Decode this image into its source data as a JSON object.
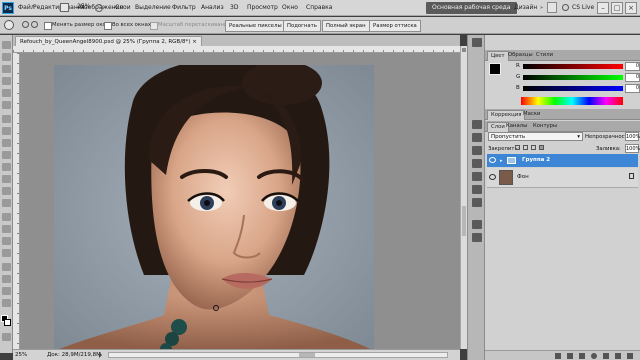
{
  "app": {
    "logo": "Ps"
  },
  "menu": {
    "items": [
      "Файл",
      "Редактирование",
      "Изображение",
      "Слои",
      "Выделение",
      "Фильтр",
      "Анализ",
      "3D",
      "Просмотр",
      "Окно",
      "Справка"
    ],
    "zoom": "25%",
    "workspace_active": "Основная рабочая среда",
    "workspace_other": "Дизайн",
    "cslive": "CS Live"
  },
  "options": {
    "resize_windows": "Менять размер окон",
    "all_windows": "Во всех окнах",
    "scrubby_zoom": "Масштаб перетаскиванием",
    "actual_pixels": "Реальные пикселы",
    "fit_screen": "Подогнать",
    "fill_screen": "Полный экран",
    "print_size": "Размер оттиска"
  },
  "document": {
    "tab_title": "Refouch_by_QueenAngel8900.psd @ 25% (Группа 2, RGB/8*) ×",
    "status_zoom": "25%",
    "status_doc": "Док: 28,9M/219,8M"
  },
  "color_panel": {
    "tabs": [
      "Цвет",
      "Образцы",
      "Стили"
    ],
    "channels": [
      {
        "label": "R",
        "value": "0"
      },
      {
        "label": "G",
        "value": "0"
      },
      {
        "label": "B",
        "value": "0"
      }
    ]
  },
  "adjust_panel": {
    "tabs": [
      "Коррекция",
      "Маски"
    ]
  },
  "layers_panel": {
    "tabs": [
      "Слои",
      "Каналы",
      "Контуры"
    ],
    "blend_mode": "Пропустить",
    "opacity_label": "Непрозрачность:",
    "opacity_value": "100%",
    "lock_label": "Закрепить:",
    "fill_label": "Заливка:",
    "fill_value": "100%",
    "layers": [
      {
        "name": "Группа 2",
        "selected": true,
        "type": "group"
      },
      {
        "name": "Фон",
        "selected": false,
        "type": "image"
      }
    ]
  },
  "colors": {
    "selection": "#3d86d6",
    "workspace_btn": "#5a5a5a"
  }
}
